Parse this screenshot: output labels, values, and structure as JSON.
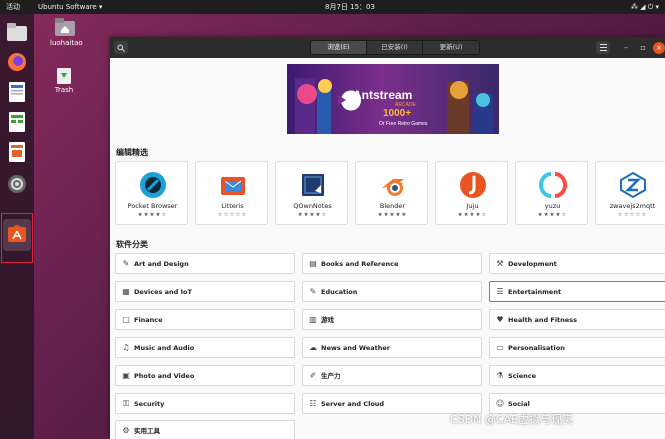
{
  "topbar": {
    "activities": "活动",
    "app_menu": "Ubuntu Software ▾",
    "clock": "8月7日  15：03",
    "indicators": "⁂ ◢ ⏻ ▾"
  },
  "desktop": {
    "home_label": "luohaitao",
    "trash_label": "Trash"
  },
  "window": {
    "tabs": [
      "浏览(E)",
      "已安装(I)",
      "更新(U)"
    ],
    "banner": {
      "brand": "Antstream",
      "brand_sub": "ARCADE",
      "offer": "1000+",
      "offer_sub": "Or Free Retro Games"
    },
    "featured_title": "编辑精选",
    "featured": [
      {
        "name": "Pocket Browser",
        "stars": "★★★★☆"
      },
      {
        "name": "Litteris",
        "stars": "☆☆☆☆☆"
      },
      {
        "name": "QOwnNotes",
        "stars": "★★★★☆"
      },
      {
        "name": "Blender",
        "stars": "★★★★★"
      },
      {
        "name": "Juju",
        "stars": "★★★★☆"
      },
      {
        "name": "yuzu",
        "stars": "★★★★☆"
      },
      {
        "name": "zwavejs2mqtt",
        "stars": "☆☆☆☆☆"
      }
    ],
    "categories_title": "软件分类",
    "categories": [
      {
        "label": "Art and Design",
        "icon": "✎"
      },
      {
        "label": "Books and Reference",
        "icon": "▤"
      },
      {
        "label": "Development",
        "icon": "⚒"
      },
      {
        "label": "Devices and IoT",
        "icon": "▦"
      },
      {
        "label": "Education",
        "icon": "✎"
      },
      {
        "label": "Entertainment",
        "icon": "☰"
      },
      {
        "label": "Finance",
        "icon": "▢"
      },
      {
        "label": "游戏",
        "icon": "▥"
      },
      {
        "label": "Health and Fitness",
        "icon": "♥"
      },
      {
        "label": "Music and Audio",
        "icon": "♫"
      },
      {
        "label": "News and Weather",
        "icon": "☁"
      },
      {
        "label": "Personalisation",
        "icon": "▭"
      },
      {
        "label": "Photo and Video",
        "icon": "▣"
      },
      {
        "label": "生产力",
        "icon": "✐"
      },
      {
        "label": "Science",
        "icon": "⚗"
      },
      {
        "label": "Security",
        "icon": "⚿"
      },
      {
        "label": "Server and Cloud",
        "icon": "☷"
      },
      {
        "label": "Social",
        "icon": "☺"
      },
      {
        "label": "实用工具",
        "icon": "⚙"
      }
    ],
    "selected_category": "Entertainment"
  },
  "watermark": "CSDN @CAE虚拟与现实"
}
